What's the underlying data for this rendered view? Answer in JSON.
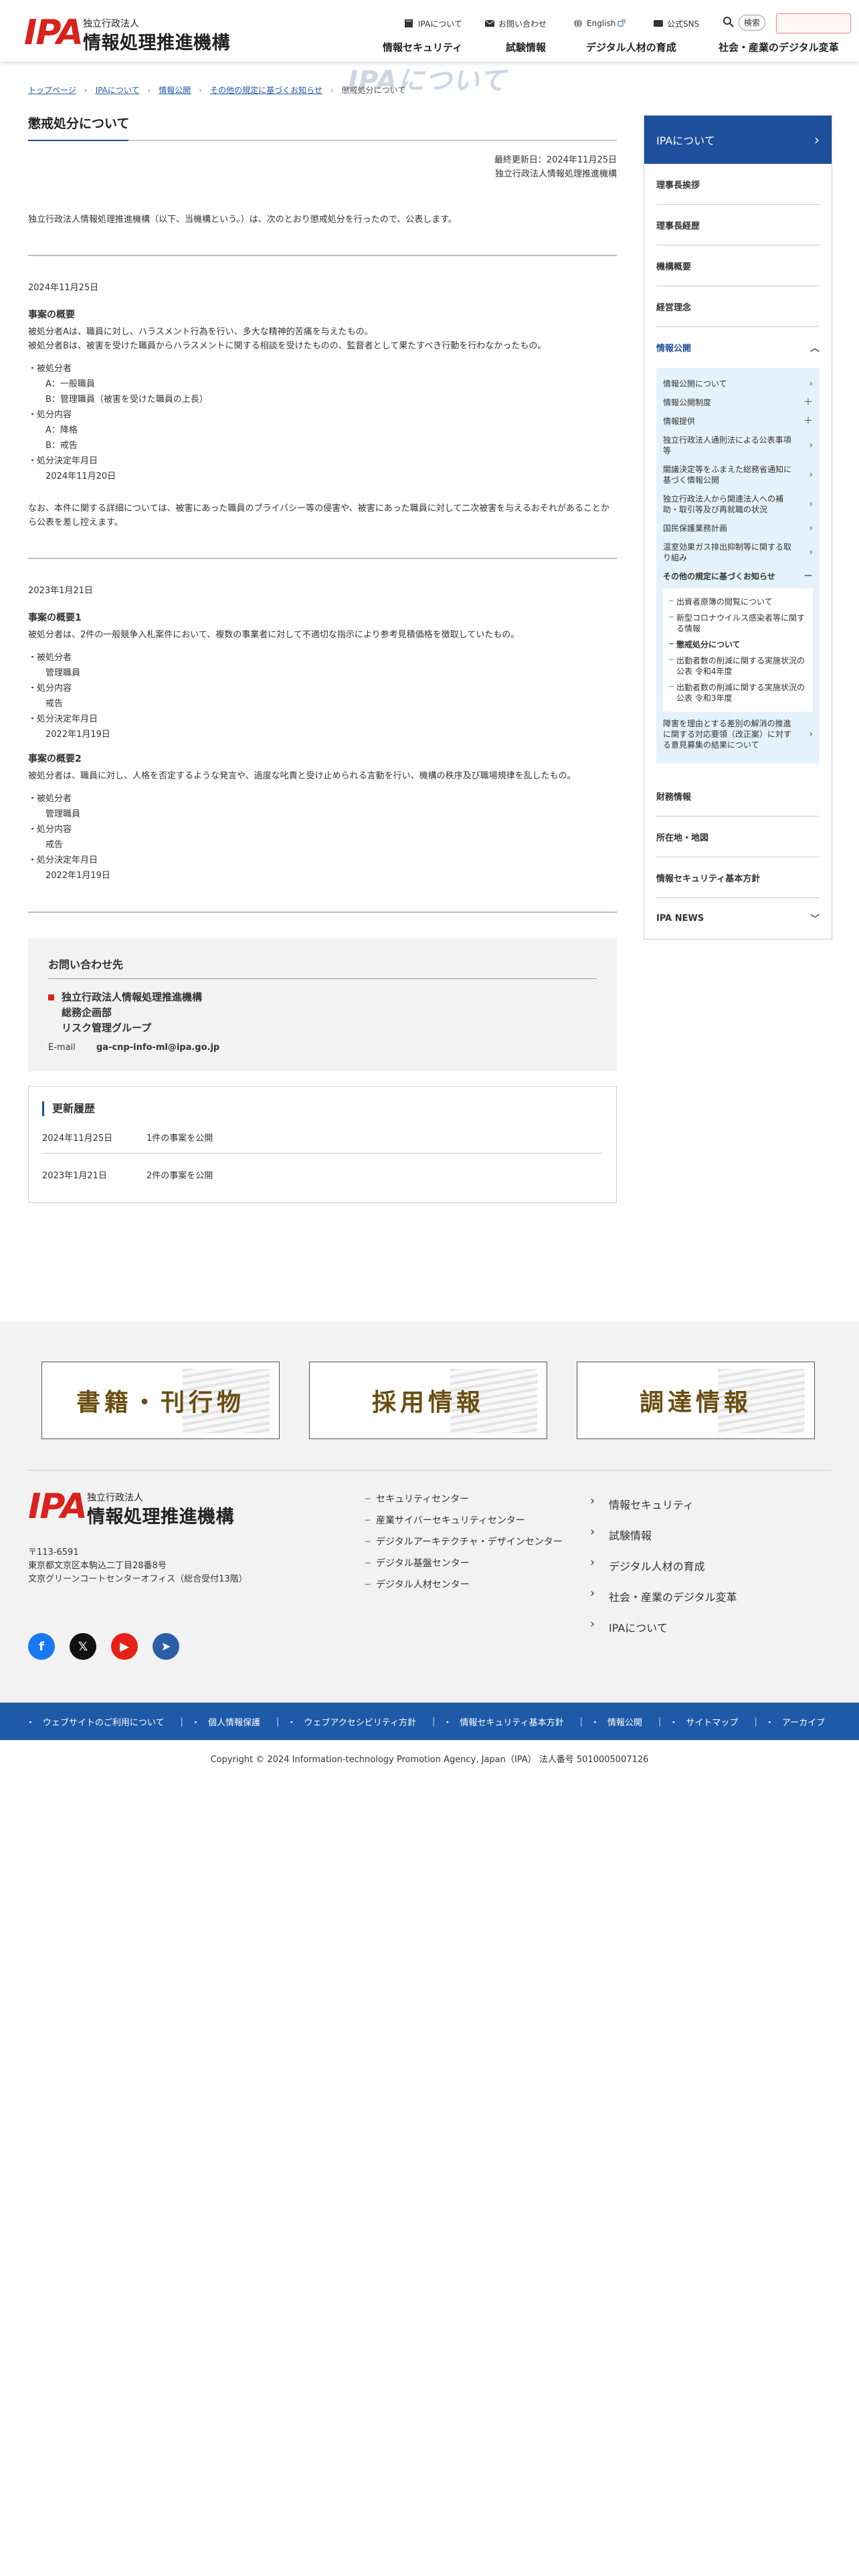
{
  "header": {
    "logo_mark": "IPA",
    "logo_sub": "独立行政法人",
    "logo_main": "情報処理推進機構",
    "util": [
      "IPAについて",
      "お問い合わせ",
      "English",
      "公式SNS"
    ],
    "search_label": "検索",
    "gnav": [
      "情報セキュリティ",
      "試験情報",
      "デジタル人材の育成",
      "社会・産業のデジタル変革"
    ]
  },
  "hero_text": "IPAについて",
  "breadcrumb": [
    "トップページ",
    "IPAについて",
    "情報公開",
    "その他の規定に基づくお知らせ",
    "懲戒処分について"
  ],
  "main": {
    "title": "懲戒処分について",
    "updated": "最終更新日：2024年11月25日",
    "org": "独立行政法人情報処理推進機構",
    "intro": "独立行政法人情報処理推進機構（以下、当機構という。）は、次のとおり懲戒処分を行ったので、公表します。",
    "case1": {
      "date": "2024年11月25日",
      "heading": "事案の概要",
      "text1": "被処分者Aは、職員に対し、ハラスメント行為を行い、多大な精神的苦痛を与えたもの。",
      "text2": "被処分者Bは、被害を受けた職員からハラスメントに関する相談を受けたものの、監督者として果たすべき行動を行わなかったもの。",
      "list": [
        {
          "dt": "被処分者",
          "dd": [
            "A：一般職員",
            "B：管理職員（被害を受けた職員の上長）"
          ]
        },
        {
          "dt": "処分内容",
          "dd": [
            "A：降格",
            "B：戒告"
          ]
        },
        {
          "dt": "処分決定年月日",
          "dd": [
            "2024年11月20日"
          ]
        }
      ],
      "note": "なお、本件に関する詳細については、被害にあった職員のプライバシー等の侵害や、被害にあった職員に対して二次被害を与えるおそれがあることから公表を差し控えます。"
    },
    "case2": {
      "date": "2023年1月21日",
      "heading1": "事案の概要1",
      "text1": "被処分者は、2件の一般競争入札案件において、複数の事業者に対して不適切な指示により参考見積価格を徴取していたもの。",
      "list1": [
        {
          "dt": "被処分者",
          "dd": [
            "管理職員"
          ]
        },
        {
          "dt": "処分内容",
          "dd": [
            "戒告"
          ]
        },
        {
          "dt": "処分決定年月日",
          "dd": [
            "2022年1月19日"
          ]
        }
      ],
      "heading2": "事案の概要2",
      "text2": "被処分者は、職員に対し、人格を否定するような発言や、過度な叱責と受け止められる言動を行い、機構の秩序及び職場規律を乱したもの。",
      "list2": [
        {
          "dt": "被処分者",
          "dd": [
            "管理職員"
          ]
        },
        {
          "dt": "処分内容",
          "dd": [
            "戒告"
          ]
        },
        {
          "dt": "処分決定年月日",
          "dd": [
            "2022年1月19日"
          ]
        }
      ]
    },
    "contact": {
      "title": "お問い合わせ先",
      "org1": "独立行政法人情報処理推進機構",
      "org2": "総務企画部",
      "org3": "リスク管理グループ",
      "mail_label": "E-mail",
      "mail": "ga-cnp-info-ml@ipa.go.jp"
    },
    "history": {
      "title": "更新履歴",
      "rows": [
        {
          "date": "2024年11月25日",
          "text": "1件の事案を公開"
        },
        {
          "date": "2023年1月21日",
          "text": "2件の事案を公開"
        }
      ]
    }
  },
  "sidebar": {
    "head": "IPAについて",
    "items": [
      "理事長挨拶",
      "理事長経歴",
      "機構概要",
      "経営理念",
      "情報公開"
    ],
    "sub": [
      "情報公開について",
      "情報公開制度",
      "情報提供",
      "独立行政法人通則法による公表事項等",
      "閣議決定等をふまえた総務省通知に基づく情報公開",
      "独立行政法人から関連法人への補助・取引等及び再就職の状況",
      "国民保護業務計画",
      "温室効果ガス排出抑制等に関する取り組み",
      "その他の規定に基づくお知らせ"
    ],
    "leaves": [
      "出資者原簿の閲覧について",
      "新型コロナウイルス感染者等に関する情報",
      "懲戒処分について",
      "出勤者数の削減に関する実施状況の公表 令和4年度",
      "出勤者数の削減に関する実施状況の公表 令和3年度"
    ],
    "sub_after": "障害を理由とする差別の解消の推進に関する対応要領（改正案）に対する意見募集の結果について",
    "items_after": [
      "財務情報",
      "所在地・地図",
      "情報セキュリティ基本方針",
      "IPA NEWS"
    ]
  },
  "footer": {
    "banners": [
      "書籍・刊行物",
      "採用情報",
      "調達情報"
    ],
    "address": [
      "〒113-6591",
      "東京都文京区本駒込二丁目28番8号",
      "文京グリーンコートセンターオフィス（総合受付13階）"
    ],
    "centers": [
      "セキュリティセンター",
      "産業サイバーセキュリティセンター",
      "デジタルアーキテクチャ・デザインセンター",
      "デジタル基盤センター",
      "デジタル人材センター"
    ],
    "cats": [
      "情報セキュリティ",
      "試験情報",
      "デジタル人材の育成",
      "社会・産業のデジタル変革",
      "IPAについて"
    ],
    "social": [
      "facebook",
      "x",
      "youtube",
      "telegram"
    ],
    "bottom_nav": [
      "ウェブサイトのご利用について",
      "個人情報保護",
      "ウェブアクセシビリティ方針",
      "情報セキュリティ基本方針",
      "情報公開",
      "サイトマップ",
      "アーカイブ"
    ],
    "copyright": "Copyright © 2024 Information-technology Promotion Agency, Japan（IPA） 法人番号 5010005007126"
  },
  "colors": {
    "brand_red": "#d7221e",
    "brand_blue": "#1e4f9c",
    "link_blue": "#1e5aa8",
    "sub_bg": "#e6f2fb"
  }
}
